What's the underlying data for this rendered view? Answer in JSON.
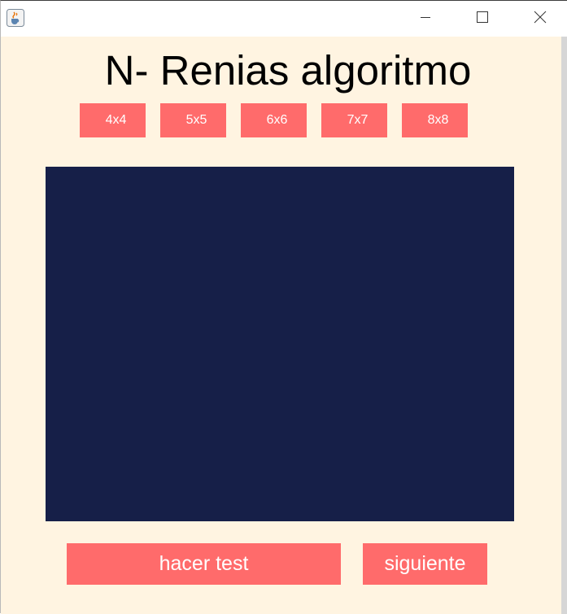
{
  "window": {
    "icons": {
      "app": "java-cup-icon",
      "minimize": "minimize-icon",
      "maximize": "maximize-icon",
      "close": "close-icon"
    }
  },
  "app": {
    "title": "N- Renias algoritmo",
    "sizes": [
      "4x4",
      "5x5",
      "6x6",
      "7x7",
      "8x8"
    ],
    "actions": {
      "test_label": "hacer test",
      "next_label": "siguiente"
    }
  },
  "colors": {
    "background": "#fff4e1",
    "button": "#ff6b6b",
    "button_text": "#ffffff",
    "board": "#161f48"
  }
}
